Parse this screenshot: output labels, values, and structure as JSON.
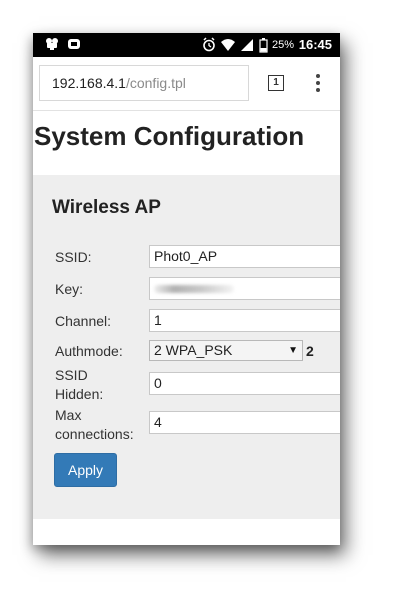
{
  "status_bar": {
    "left_icons": [
      "app-notification-icon",
      "app-notification-icon"
    ],
    "right_icons": [
      "alarm-icon",
      "wifi-icon",
      "signal-icon",
      "battery-icon"
    ],
    "battery": "25%",
    "time": "16:45"
  },
  "browser": {
    "url_host": "192.168.4.1",
    "url_path": "/config.tpl",
    "tab_count": "1",
    "menu_icon": "overflow-menu-icon"
  },
  "page": {
    "title": "System Configuration",
    "section_title": "Wireless AP"
  },
  "form": {
    "ssid_label": "SSID:",
    "ssid_value": "Phot0_AP",
    "key_label": "Key:",
    "channel_label": "Channel:",
    "channel_value": "1",
    "authmode_label": "Authmode:",
    "authmode_selected": "2 WPA_PSK",
    "authmode_extra": "2",
    "ssid_hidden_label_1": "SSID",
    "ssid_hidden_label_2": "Hidden:",
    "ssid_hidden_value": "0",
    "max_conn_label_1": "Max",
    "max_conn_label_2": "connections:",
    "max_conn_value": "4",
    "apply_label": "Apply"
  },
  "colors": {
    "button": "#337ab7",
    "panel": "#eeeeee",
    "status_bar": "#000000"
  }
}
